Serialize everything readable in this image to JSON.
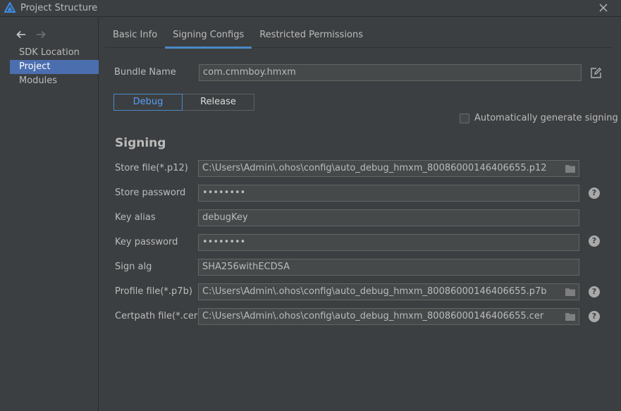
{
  "window": {
    "title": "Project Structure"
  },
  "sidebar": {
    "items": [
      {
        "label": "SDK Location"
      },
      {
        "label": "Project"
      },
      {
        "label": "Modules"
      }
    ]
  },
  "tabs": [
    {
      "label": "Basic Info"
    },
    {
      "label": "Signing Configs"
    },
    {
      "label": "Restricted Permissions"
    }
  ],
  "bundle": {
    "label": "Bundle Name",
    "value": "com.cmmboy.hmxm"
  },
  "build_types": {
    "debug": "Debug",
    "release": "Release",
    "selected": "Debug"
  },
  "auto_sign": {
    "label": "Automatically generate signing",
    "checked": false
  },
  "signing": {
    "title": "Signing",
    "store_file": {
      "label": "Store file(*.p12)",
      "value": "C:\\Users\\Admin\\.ohos\\config\\auto_debug_hmxm_80086000146406655.p12"
    },
    "store_password": {
      "label": "Store password",
      "value": "••••••••"
    },
    "key_alias": {
      "label": "Key alias",
      "value": "debugKey"
    },
    "key_password": {
      "label": "Key password",
      "value": "••••••••"
    },
    "sign_alg": {
      "label": "Sign alg",
      "value": "SHA256withECDSA"
    },
    "profile_file": {
      "label": "Profile file(*.p7b)",
      "value": "C:\\Users\\Admin\\.ohos\\config\\auto_debug_hmxm_80086000146406655.p7b"
    },
    "certpath_file": {
      "label": "Certpath file(*.cer)",
      "value": "C:\\Users\\Admin\\.ohos\\config\\auto_debug_hmxm_80086000146406655.cer"
    }
  },
  "colors": {
    "accent": "#4a88c7",
    "selection": "#4b6eaf",
    "background": "#3c3f41"
  }
}
